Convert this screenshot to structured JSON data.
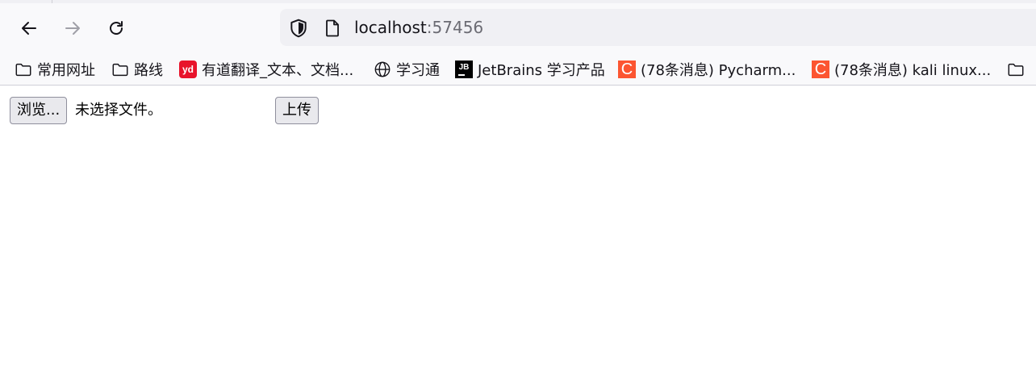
{
  "address_bar": {
    "host": "localhost",
    "port": ":57456"
  },
  "bookmarks": [
    {
      "label": "常用网址",
      "icon": "folder-icon"
    },
    {
      "label": "路线",
      "icon": "folder-icon"
    },
    {
      "label": "有道翻译_文本、文档...",
      "icon": "youdao-icon",
      "icon_text": "yd"
    },
    {
      "label": "学习通",
      "icon": "globe-icon"
    },
    {
      "label": "JetBrains 学习产品",
      "icon": "jetbrains-icon",
      "icon_text": "JB"
    },
    {
      "label": "(78条消息) Pycharm...",
      "icon": "csdn-icon",
      "icon_text": "C"
    },
    {
      "label": "(78条消息) kali linux...",
      "icon": "csdn-icon",
      "icon_text": "C"
    },
    {
      "label": "",
      "icon": "folder-icon"
    }
  ],
  "form": {
    "browse_label": "浏览...",
    "file_status": "未选择文件。",
    "upload_label": "上传"
  },
  "colors": {
    "toolbar_bg": "#f9f9fb",
    "urlbar_bg": "#f0f0f4",
    "youdao": "#e8132b",
    "csdn": "#fc5531"
  }
}
